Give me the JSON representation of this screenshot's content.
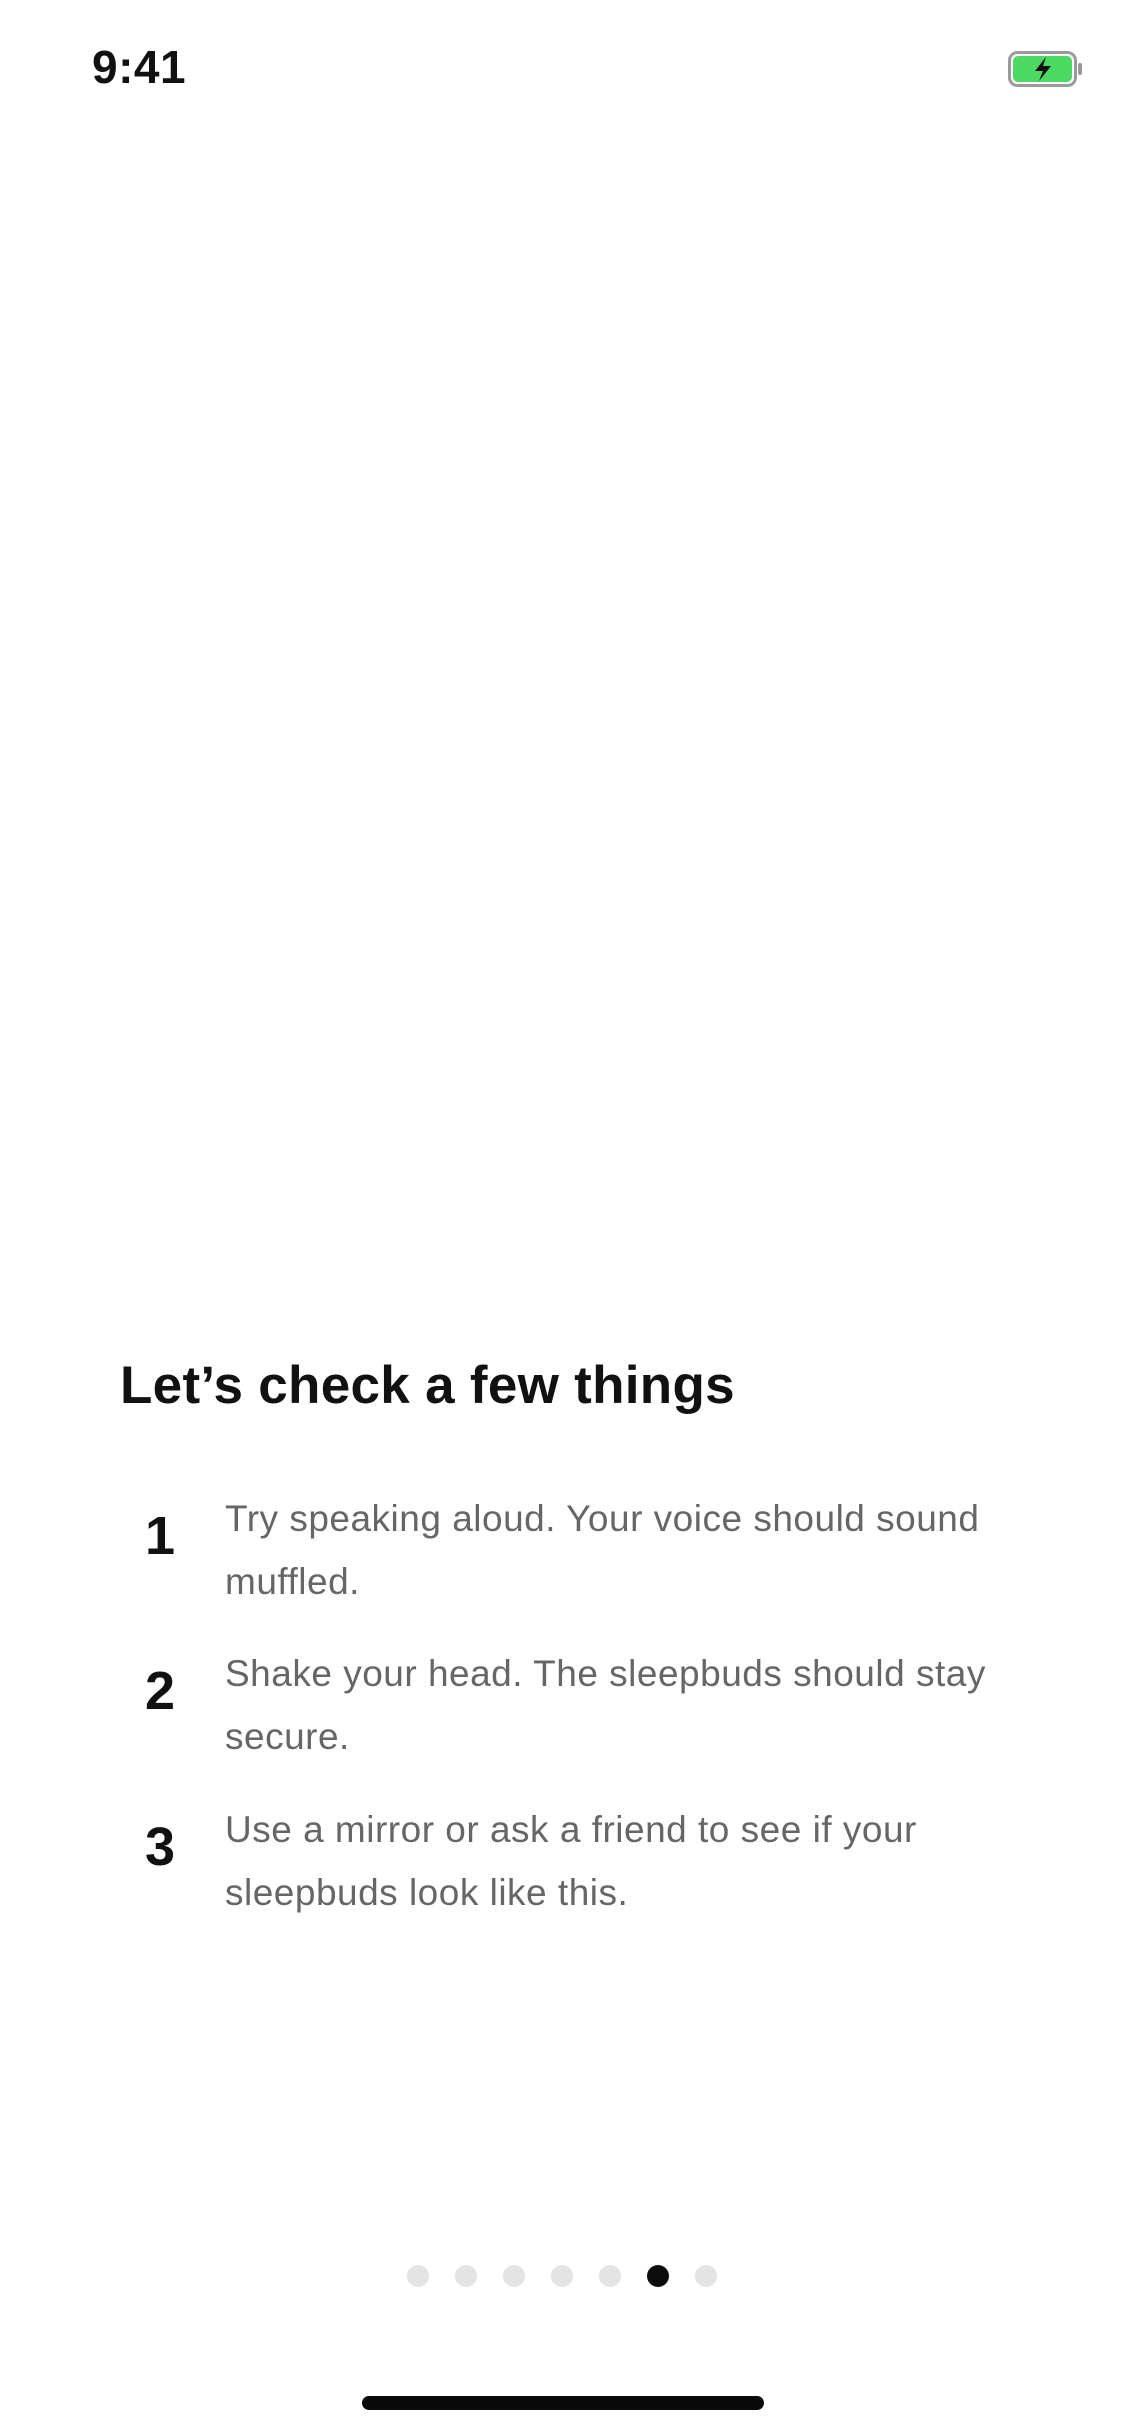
{
  "status_bar": {
    "time": "9:41",
    "battery_icon": "battery-charging-icon",
    "battery_color": "#4cd964"
  },
  "main": {
    "title": "Let’s check a few things",
    "steps": [
      {
        "number": "1",
        "text": "Try speaking aloud. Your voice should sound muffled."
      },
      {
        "number": "2",
        "text": "Shake your head. The sleepbuds should stay secure."
      },
      {
        "number": "3",
        "text": "Use a mirror or ask a friend to see if your sleepbuds look like this."
      }
    ]
  },
  "pagination": {
    "total_pages": 7,
    "current_page": 6,
    "active_color": "#0c0c0c",
    "inactive_color": "#e4e4e4"
  }
}
